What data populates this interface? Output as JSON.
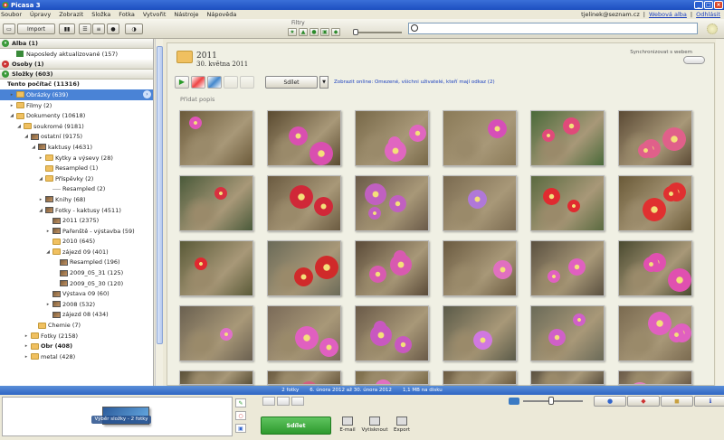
{
  "window": {
    "title": "Picasa 3"
  },
  "menu": {
    "items": [
      "Soubor",
      "Úpravy",
      "Zobrazit",
      "Složka",
      "Fotka",
      "Vytvořit",
      "Nástroje",
      "Nápověda"
    ]
  },
  "account": {
    "email": "tjelinek@seznam.cz",
    "web_albums": "Webová alba",
    "logout": "Odhlásit"
  },
  "toolbar": {
    "import_label": "Import",
    "filters_label": "Filtry",
    "search_placeholder": ""
  },
  "sidebar": {
    "sections": [
      {
        "label": "Alba (1)"
      },
      {
        "label": "Osoby (1)"
      },
      {
        "label": "Složky (603)"
      }
    ],
    "album_item": "Naposledy aktualizované (157)",
    "tree": [
      {
        "label": "Tento počítač (11316)",
        "level": 0,
        "icon": "none",
        "arrow": "",
        "bold": true
      },
      {
        "label": "Obrázky (639)",
        "level": 1,
        "icon": "folder",
        "arrow": "▸",
        "selected": true
      },
      {
        "label": "Filmy (2)",
        "level": 1,
        "icon": "folder",
        "arrow": "▸"
      },
      {
        "label": "Dokumenty (10618)",
        "level": 1,
        "icon": "folder",
        "arrow": "◢"
      },
      {
        "label": "soukromé (9181)",
        "level": 2,
        "icon": "folder",
        "arrow": "◢"
      },
      {
        "label": "ostatní (9175)",
        "level": 3,
        "icon": "thumb",
        "arrow": "◢"
      },
      {
        "label": "kaktusy (4631)",
        "level": 4,
        "icon": "thumb",
        "arrow": "◢"
      },
      {
        "label": "Kytky a výsevy (28)",
        "level": 5,
        "icon": "folder",
        "arrow": "▸"
      },
      {
        "label": "Resampled (1)",
        "level": 5,
        "icon": "folder",
        "arrow": ""
      },
      {
        "label": "Příspěvky (2)",
        "level": 5,
        "icon": "folder",
        "arrow": "◢"
      },
      {
        "label": "Resampled (2)",
        "level": 6,
        "icon": "line",
        "arrow": ""
      },
      {
        "label": "Knihy (68)",
        "level": 5,
        "icon": "thumb",
        "arrow": "▸"
      },
      {
        "label": "Fotky - kaktusy (4511)",
        "level": 5,
        "icon": "thumb",
        "arrow": "◢"
      },
      {
        "label": "2011 (2375)",
        "level": 6,
        "icon": "thumb",
        "arrow": ""
      },
      {
        "label": "Pařenště - výstavba (59)",
        "level": 6,
        "icon": "thumb",
        "arrow": "▸"
      },
      {
        "label": "2010 (645)",
        "level": 6,
        "icon": "folder",
        "arrow": ""
      },
      {
        "label": "zájezd 09 (401)",
        "level": 6,
        "icon": "folder",
        "arrow": "◢"
      },
      {
        "label": "Resampled (196)",
        "level": 7,
        "icon": "thumb",
        "arrow": ""
      },
      {
        "label": "2009_05_31 (125)",
        "level": 7,
        "icon": "thumb",
        "arrow": ""
      },
      {
        "label": "2009_05_30 (120)",
        "level": 7,
        "icon": "thumb",
        "arrow": ""
      },
      {
        "label": "Výstava 09 (60)",
        "level": 6,
        "icon": "thumb",
        "arrow": ""
      },
      {
        "label": "2008 (532)",
        "level": 6,
        "icon": "thumb",
        "arrow": "▸"
      },
      {
        "label": "zájezd 08 (434)",
        "level": 6,
        "icon": "thumb",
        "arrow": ""
      },
      {
        "label": "Chemie (7)",
        "level": 4,
        "icon": "folder",
        "arrow": ""
      },
      {
        "label": "Fotky (2158)",
        "level": 3,
        "icon": "folder",
        "arrow": "▸"
      },
      {
        "label": "Obr (408)",
        "level": 3,
        "icon": "folder",
        "arrow": "▸",
        "bold": true
      },
      {
        "label": "metal (428)",
        "level": 3,
        "icon": "folder",
        "arrow": "▸"
      }
    ]
  },
  "main": {
    "album_title": "2011",
    "album_date": "30. května 2011",
    "sync_label": "Synchronizovat s webem",
    "share_label": "Sdílet",
    "share_info": "Zobrazit online: Omezené, všichni uživatelé, kteří mají odkaz (2)",
    "caption_link": "Přidat popis"
  },
  "status": {
    "count": "2 fotky",
    "range": "6. února 2012 až 30. února 2012",
    "size": "1,1 MB na disku"
  },
  "tray": {
    "selection_label": "Výběr složky - 2 fotky",
    "share_button": "Sdílet",
    "email": "E-mail",
    "print": "Vytisknout",
    "export": "Export"
  },
  "colors": {
    "accent": "#2f66c4",
    "share_green": "#2e9a2e",
    "selection": "#4a83d6"
  }
}
